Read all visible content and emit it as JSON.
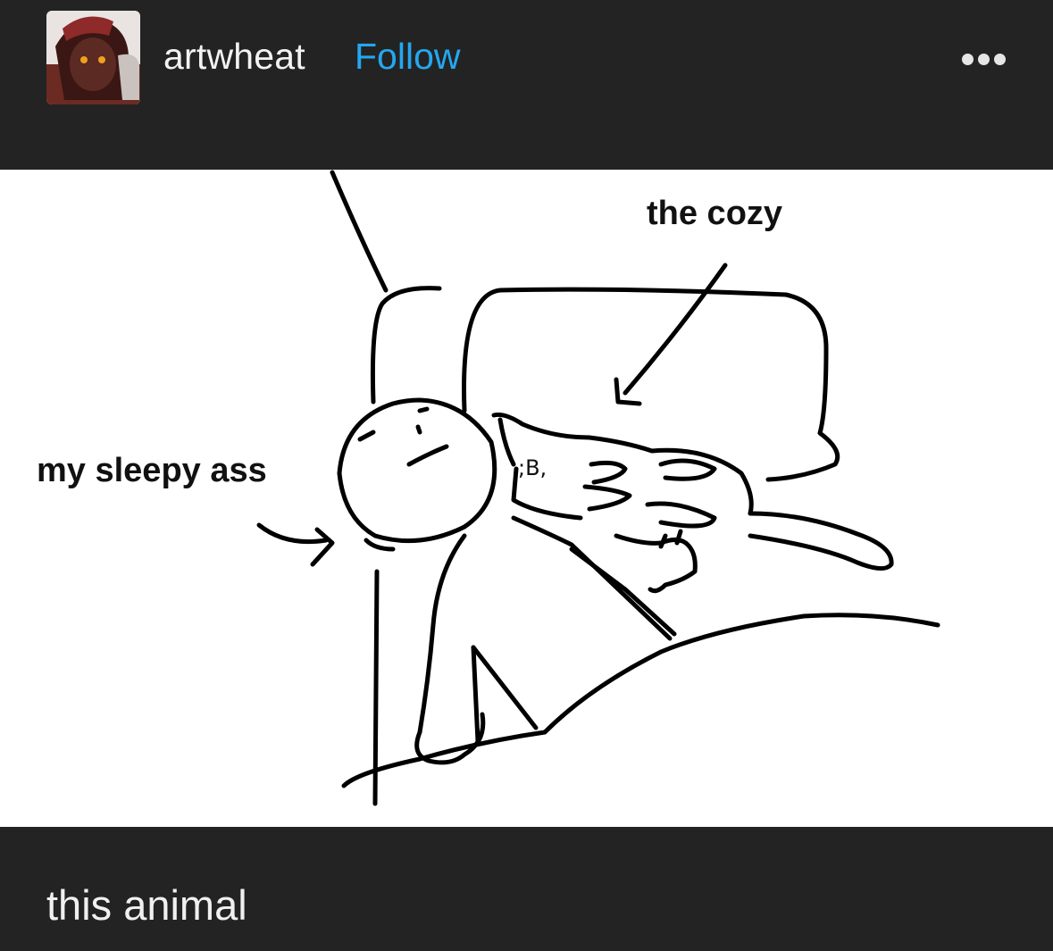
{
  "post": {
    "username": "artwheat",
    "follow_label": "Follow",
    "more_icon": "ellipsis-icon",
    "image": {
      "label_cozy": "the cozy",
      "label_sleepy": "my sleepy ass",
      "cat_mark": ";B,"
    },
    "caption": "this animal"
  }
}
